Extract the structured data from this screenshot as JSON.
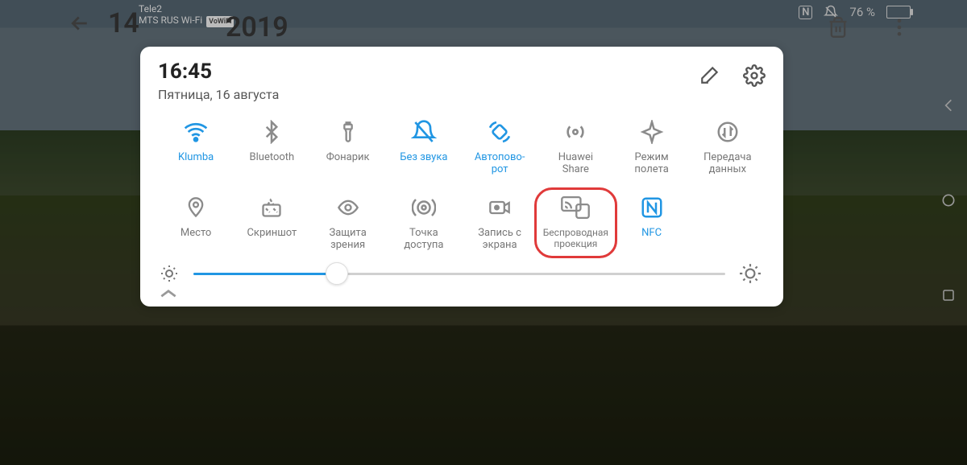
{
  "status_bar": {
    "carrier1": "Tele2",
    "carrier2": "MTS RUS Wi-Fi",
    "vowifi_badge": "VoWiFi",
    "battery_percent": "76 %",
    "nfc_label": "N"
  },
  "background_app": {
    "date_big": "14",
    "year_fragment": "2019"
  },
  "panel": {
    "time": "16:45",
    "date": "Пятница, 16 августа"
  },
  "tiles": [
    {
      "id": "wifi",
      "label": "Klumba",
      "active": true
    },
    {
      "id": "bluetooth",
      "label": "Bluetooth",
      "active": false
    },
    {
      "id": "flashlight",
      "label": "Фонарик",
      "active": false
    },
    {
      "id": "silent",
      "label": "Без звука",
      "active": true
    },
    {
      "id": "autorotate",
      "label": "Автоповорот",
      "active": true,
      "label_wrap": "Автопово-\nрот"
    },
    {
      "id": "huaweishare",
      "label": "Huawei Share",
      "active": false,
      "label_wrap": "Huawei\nShare"
    },
    {
      "id": "airplane",
      "label": "Режим полета",
      "active": false,
      "label_wrap": "Режим\nполета"
    },
    {
      "id": "mobiledata",
      "label": "Передача данных",
      "active": false,
      "label_wrap": "Передача\nданных"
    },
    {
      "id": "location",
      "label": "Место",
      "active": false
    },
    {
      "id": "screenshot",
      "label": "Скриншот",
      "active": false
    },
    {
      "id": "eyecomfort",
      "label": "Защита зрения",
      "active": false,
      "label_wrap": "Защита\nзрения"
    },
    {
      "id": "hotspot",
      "label": "Точка доступа",
      "active": false,
      "label_wrap": "Точка\nдоступа"
    },
    {
      "id": "screenrecord",
      "label": "Запись с экрана",
      "active": false,
      "label_wrap": "Запись с\nэкрана"
    },
    {
      "id": "wirelessprojection",
      "label": "Беcпроводная проекция",
      "active": false,
      "highlight": true,
      "label_wrap": "Беспроводная\nпроекция"
    },
    {
      "id": "nfc",
      "label": "NFC",
      "active": true
    }
  ],
  "slider": {
    "value_percent": 27
  },
  "colors": {
    "accent": "#2196e3",
    "highlight_border": "#e03a3a"
  }
}
